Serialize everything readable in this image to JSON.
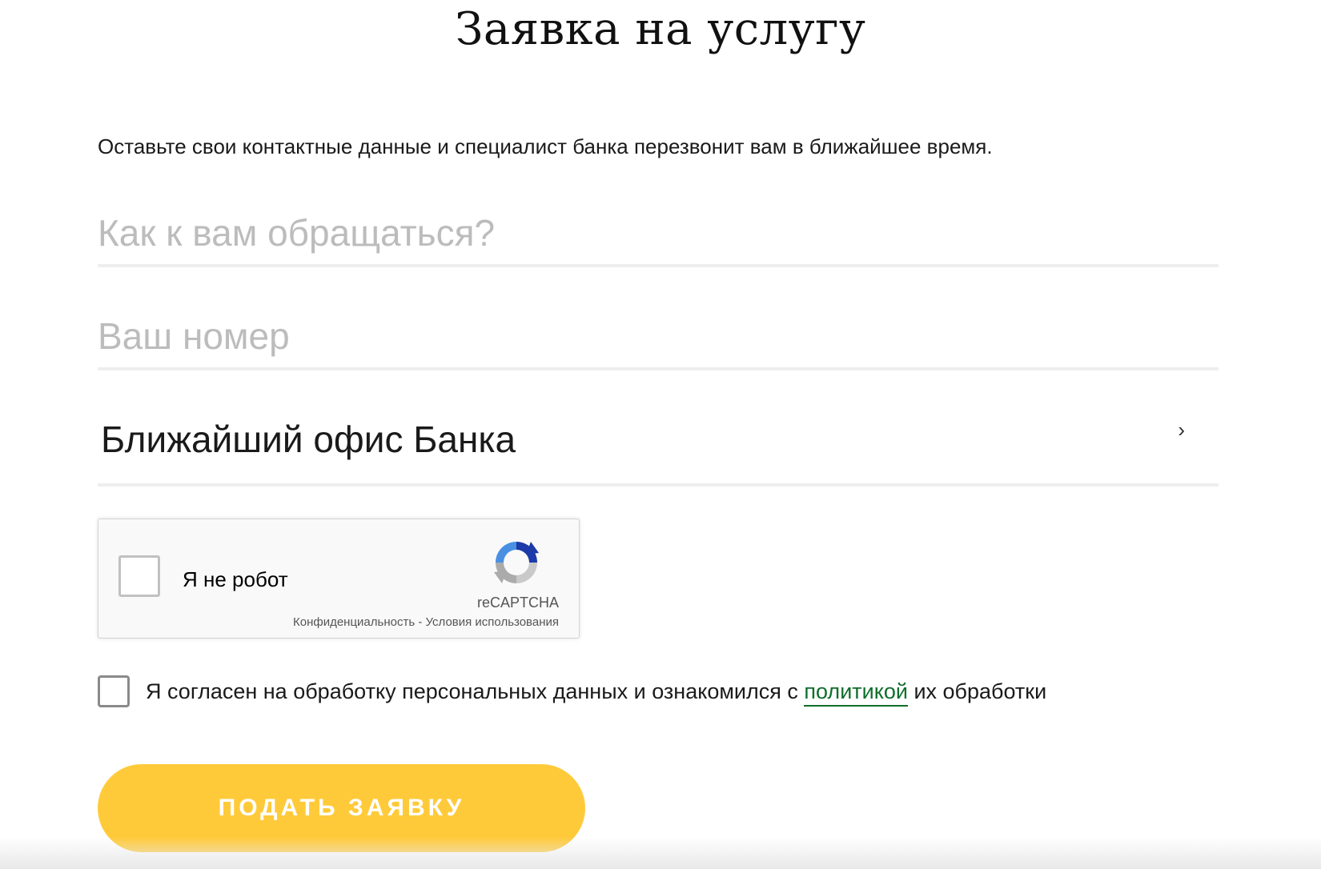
{
  "header": {
    "title": "Заявка на услугу"
  },
  "form": {
    "subtitle": "Оставьте свои контактные данные и специалист банка перезвонит вам в ближайшее время.",
    "name_field": {
      "placeholder": "Как к вам обращаться?",
      "value": ""
    },
    "phone_field": {
      "placeholder": "Ваш номер",
      "value": ""
    },
    "office_select": {
      "label": "Ближайший офис Банка",
      "icon": "chevron-right-icon"
    },
    "recaptcha": {
      "label": "Я не робот",
      "brand": "reCAPTCHA",
      "privacy_link": "Конфиденциальность",
      "separator": " - ",
      "terms_link": "Условия использования",
      "checked": false
    },
    "consent": {
      "text_before": "Я согласен на обработку персональных данных и ознакомился с ",
      "link_text": "политикой",
      "text_after": " их обработки",
      "checked": false
    },
    "submit_label": "ПОДАТЬ ЗАЯВКУ"
  },
  "colors": {
    "accent_button": "#ffca3a",
    "link": "#0f6e2b",
    "placeholder": "#bcbcbc",
    "field_border": "#eeeeee"
  }
}
